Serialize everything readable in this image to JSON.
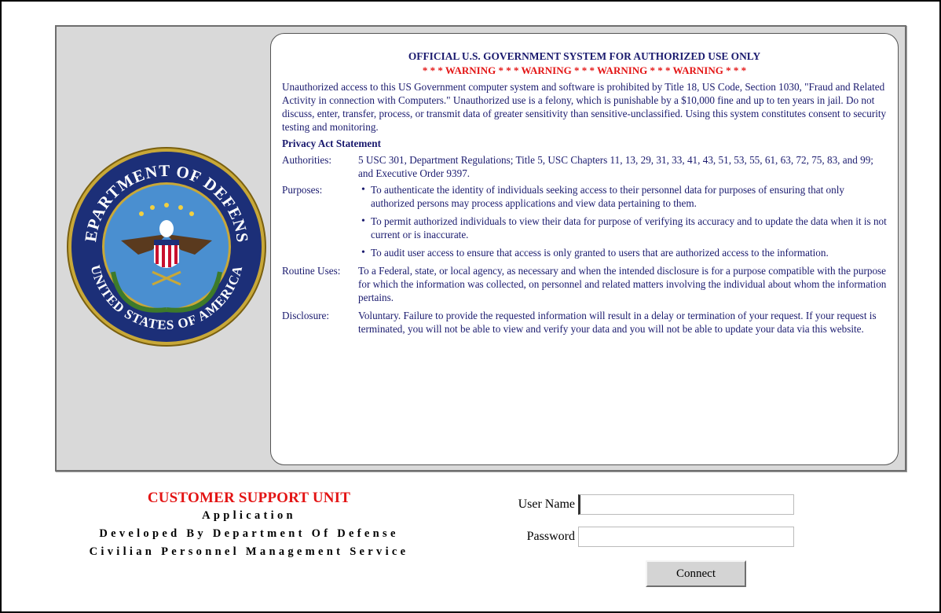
{
  "seal": {
    "top_text": "DEPARTMENT OF DEFENSE",
    "bottom_text": "UNITED STATES OF AMERICA"
  },
  "notice": {
    "title": "OFFICIAL U.S. GOVERNMENT SYSTEM FOR AUTHORIZED USE ONLY",
    "warning": "* * * WARNING * * * WARNING * * * WARNING * * * WARNING * * *",
    "intro": "Unauthorized access to this US Government computer system and software is prohibited by Title 18, US Code, Section 1030, \"Fraud and Related Activity in connection with Computers.\" Unauthorized use is a felony, which is punishable by a $10,000 fine and up to ten years in jail. Do not discuss, enter, transfer, process, or transmit data of greater sensitivity than sensitive-unclassified. Using this system constitutes consent to security testing and monitoring.",
    "privacy_title": "Privacy Act Statement",
    "authorities_label": "Authorities:",
    "authorities_text": "5 USC 301, Department Regulations; Title 5, USC Chapters 11, 13, 29, 31, 33, 41, 43, 51, 53, 55, 61, 63, 72, 75, 83, and 99; and Executive Order 9397.",
    "purposes_label": "Purposes:",
    "purposes": [
      "To authenticate the identity of individuals seeking access to their personnel data for purposes of ensuring that only authorized persons may process applications and view data pertaining to them.",
      "To permit authorized individuals to view their data for purpose of verifying its accuracy and to update the data when it is not current or is inaccurate.",
      "To audit user access to ensure that access is only granted to users that are authorized access to the information."
    ],
    "routine_label": "Routine Uses:",
    "routine_text": "To a Federal, state, or local agency, as necessary and when the intended disclosure is for a purpose compatible with the purpose for which the information was collected, on personnel and related matters involving the individual about whom the information pertains.",
    "disclosure_label": "Disclosure:",
    "disclosure_text": "Voluntary. Failure to provide the requested information will result in a delay or termination of your request. If your request is terminated, you will not be able to view and verify your data and you will not be able to update your data via this website."
  },
  "footer": {
    "unit": "CUSTOMER SUPPORT UNIT",
    "line1": "Application",
    "line2": "Developed By Department Of Defense",
    "line3": "Civilian Personnel Management Service"
  },
  "login": {
    "username_label": "User Name",
    "username_value": "",
    "password_label": "Password",
    "password_value": "",
    "connect_label": "Connect"
  },
  "colors": {
    "notice_text": "#1a1a6e",
    "warning": "#e31414",
    "panel_bg": "#d9d9d9"
  }
}
